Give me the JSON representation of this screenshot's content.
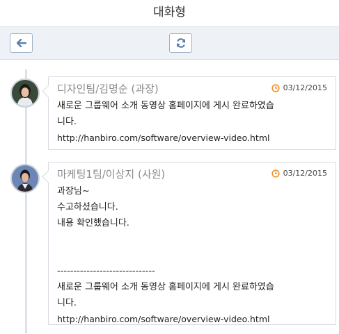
{
  "header": {
    "title": "대화형"
  },
  "toolbar": {
    "back_icon": "arrow-left-icon",
    "refresh_icon": "refresh-icon"
  },
  "messages": [
    {
      "author": "디자인팀/김명순 (과장)",
      "date": "03/12/2015",
      "lines": [
        "새로운 그룹웨어 소개 동영상 홈페이지에 게시 완료하였습",
        "니다.",
        "http://hanbiro.com/software/overview-video.html"
      ]
    },
    {
      "author": "마케팅1팀/이상지 (사원)",
      "date": "03/12/2015",
      "lines": [
        "과장님~",
        "수고하셨습니다.",
        "내용 확인했습니다.",
        "",
        "",
        "------------------------------",
        "새로운 그룹웨어 소개 동영상 홈페이지에 게시 완료하였습",
        "니다.",
        "http://hanbiro.com/software/overview-video.html"
      ]
    }
  ],
  "colors": {
    "accent_orange": "#f0902b",
    "toolbar_bg": "#eef1f6",
    "border": "#d7dce3"
  }
}
